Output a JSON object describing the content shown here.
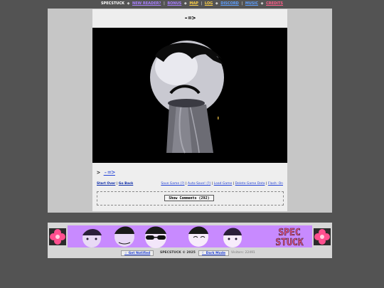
{
  "nav": {
    "brand": "SPECSTUCK",
    "items": [
      {
        "label": "NEW READER?",
        "color": "#a980ff"
      },
      {
        "label": "BONUS",
        "color": "#a980ff"
      },
      {
        "label": "MAP",
        "color": "#ffd24a"
      },
      {
        "label": "LOG",
        "color": "#ffd24a"
      },
      {
        "label": "DISCORD",
        "color": "#5fa0ff"
      },
      {
        "label": "MUSIC",
        "color": "#5fa0ff"
      },
      {
        "label": "CREDITS",
        "color": "#ff5f8a"
      }
    ],
    "separators": [
      "◆",
      "|",
      "◆",
      "|",
      "◆",
      "|",
      "◆"
    ]
  },
  "page": {
    "title": "-=>",
    "prompt": ">",
    "next_link": "-=>",
    "start_over": "Start Over",
    "go_back": "Go Back",
    "save_game": "Save Game (?)",
    "auto_save": "Auto-Save! (?)",
    "load_game": "Load Game",
    "delete_game": "Delete Game Data",
    "flash": "Flash: On",
    "show_comments": "Show Comments (292)"
  },
  "footer": {
    "banner_text_line1": "SPEC",
    "banner_text_line2": "STUCK",
    "get_notified": "☆ Get Notified",
    "copyright": "SPECSTUCK © 2025",
    "dark_mode": "☾ Dark Mode",
    "visitors": "Visitors: 22491"
  },
  "colors": {
    "background": "#535353",
    "frame": "#c6c6c6",
    "panel": "#eeeeee",
    "link": "#1f3fd6",
    "banner_bg": "#c88aff",
    "banner_accent": "#ff4f8f"
  }
}
